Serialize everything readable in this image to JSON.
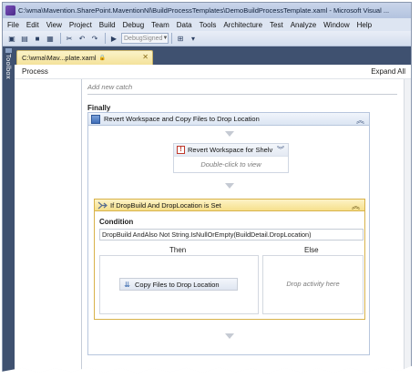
{
  "window": {
    "title": "C:\\wma\\Mavention.SharePoint.MaventionNl\\BuildProcessTemplates\\DemoBuildProcessTemplate.xaml - Microsoft Visual ..."
  },
  "menu": {
    "items": [
      "File",
      "Edit",
      "View",
      "Project",
      "Build",
      "Debug",
      "Team",
      "Data",
      "Tools",
      "Architecture",
      "Test",
      "Analyze",
      "Window",
      "Help"
    ]
  },
  "toolbar": {
    "config_value": "DebugSigned"
  },
  "toolbox": {
    "label": "Toolbox"
  },
  "document_tab": {
    "label": "C:\\wma\\Mav...plate.xaml"
  },
  "designer": {
    "breadcrumb": "Process",
    "expand_all": "Expand All",
    "add_catch": "Add new catch",
    "finally_label": "Finally",
    "sequence": {
      "title": "Revert Workspace and Copy Files to Drop Location"
    },
    "revert_activity": {
      "title": "Revert Workspace for Shelv",
      "hint": "Double-click to view"
    },
    "if_activity": {
      "title": "If DropBuild And DropLocation is Set",
      "condition_label": "Condition",
      "condition_value": "DropBuild AndAlso Not String.IsNullOrEmpty(BuildDetail.DropLocation)",
      "then_label": "Then",
      "else_label": "Else",
      "then_activity": "Copy Files to Drop Location",
      "else_hint": "Drop activity here"
    }
  }
}
